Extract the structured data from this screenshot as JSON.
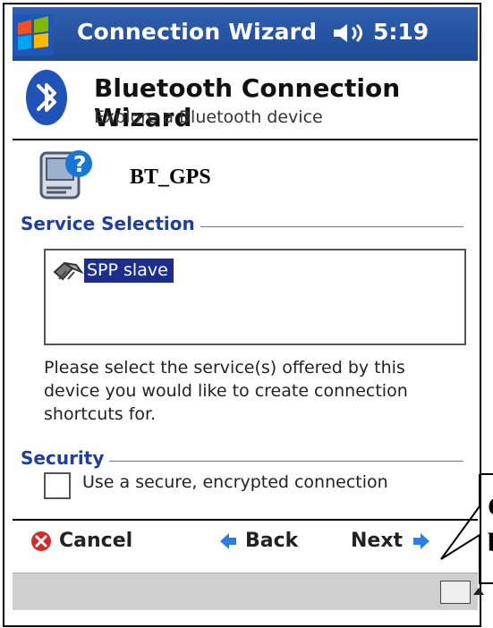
{
  "window": {
    "title": "Connection Wizard",
    "time": "5:19",
    "start_icon": "windows-flag-icon",
    "speaker_icon": "speaker-icon"
  },
  "header": {
    "title": "Bluetooth Connection Wizard",
    "subtitle": "Explore a Bluetooth device",
    "icon": "bluetooth-icon"
  },
  "device": {
    "name": "BT_GPS",
    "icon": "device-help-icon"
  },
  "service_selection": {
    "label": "Service Selection",
    "items": [
      {
        "label": "SPP slave",
        "icon": "service-icon"
      }
    ],
    "instructions": "Please select the service(s) offered by this device you would like to create connection shortcuts for."
  },
  "security": {
    "label": "Security",
    "checkbox_label": "Use a secure, encrypted connection",
    "checked": false
  },
  "commands": {
    "cancel": "Cancel",
    "back": "Back",
    "next": "Next",
    "cancel_icon": "cancel-icon",
    "back_icon": "back-arrow-icon",
    "next_icon": "next-arrow-icon"
  },
  "bottom_bar": {
    "keyboard_icon": "keyboard-icon",
    "arrow_icon": "up-arrow-icon"
  },
  "callout": {
    "line1": "C",
    "line2": "b"
  },
  "colors": {
    "titlebar": "#2f5fae",
    "selection": "#1d2d8e",
    "group_label": "#1f3f9a",
    "background": "#ffffff",
    "status_strip": "#cfcfcf"
  }
}
